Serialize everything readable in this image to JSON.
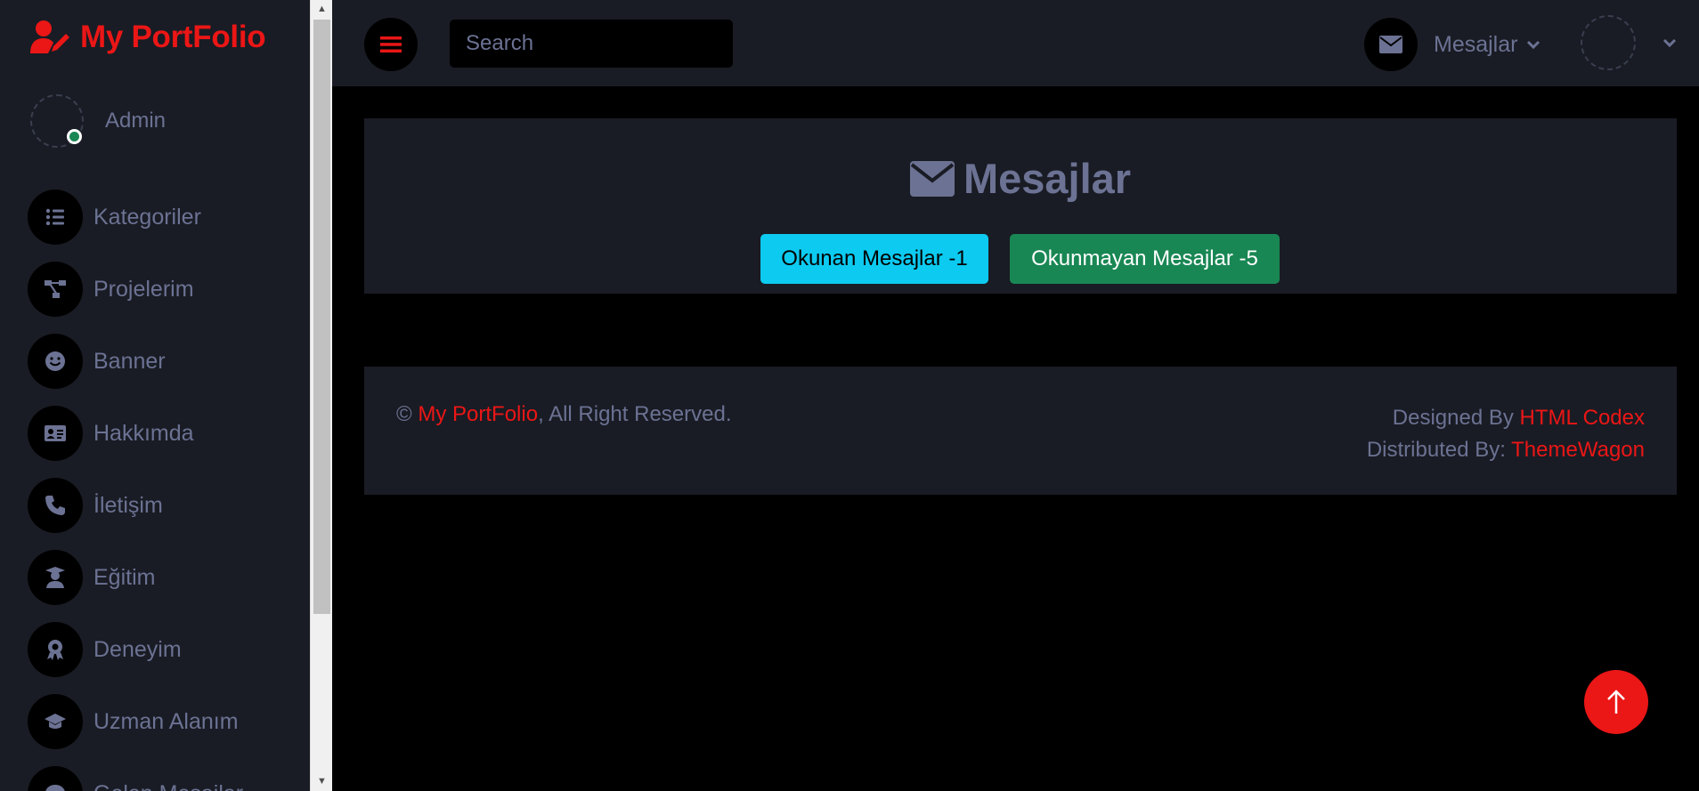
{
  "brand": {
    "name": "My PortFolio"
  },
  "profile": {
    "name": "Admin"
  },
  "sidebar": {
    "items": [
      {
        "label": "Kategoriler",
        "icon": "list-icon"
      },
      {
        "label": "Projelerim",
        "icon": "sitemap-icon"
      },
      {
        "label": "Banner",
        "icon": "smile-icon"
      },
      {
        "label": "Hakkımda",
        "icon": "id-card-icon"
      },
      {
        "label": "İletişim",
        "icon": "phone-icon"
      },
      {
        "label": "Eğitim",
        "icon": "graduate-icon"
      },
      {
        "label": "Deneyim",
        "icon": "award-icon"
      },
      {
        "label": "Uzman Alanım",
        "icon": "graduation-cap-icon"
      },
      {
        "label": "Gelen Mesajlar",
        "icon": "comment-icon"
      }
    ]
  },
  "topbar": {
    "search_placeholder": "Search",
    "messages_label": "Mesajlar"
  },
  "main": {
    "title": "Mesajlar",
    "read_button": "Okunan Mesajlar -1",
    "unread_button": "Okunmayan Mesajlar -5"
  },
  "footer": {
    "copyright_symbol": "©",
    "brand_link": "My PortFolio",
    "rights": ", All Right Reserved.",
    "designed_prefix": "Designed By",
    "designed_link": "HTML Codex",
    "distributed_prefix": "Distributed By:",
    "distributed_link": "ThemeWagon"
  },
  "colors": {
    "accent": "#EB1616",
    "sidebar_bg": "#191C24",
    "text_muted": "#6C7293",
    "info": "#0DCAF0",
    "success": "#198754"
  }
}
